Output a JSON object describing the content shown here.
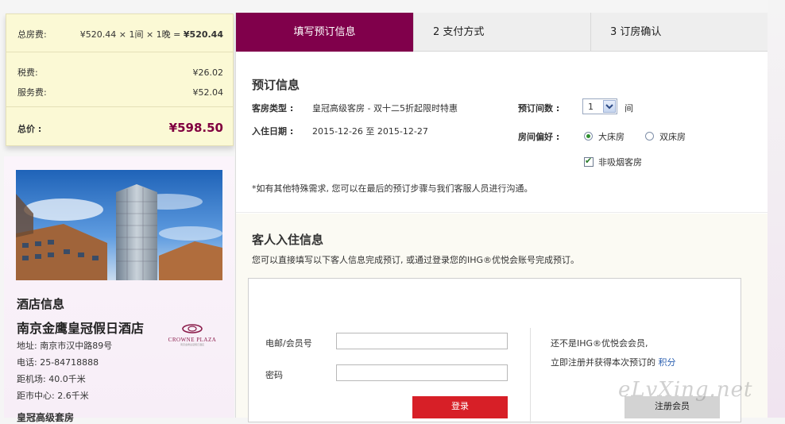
{
  "price": {
    "room_label": "总房费:",
    "room_formula": "¥520.44 × 1间 × 1晚 =",
    "room_total": "¥520.44",
    "tax_label": "税费:",
    "tax_value": "¥26.02",
    "service_label": "服务费:",
    "service_value": "¥52.04",
    "total_label": "总价 :",
    "total_value": "¥598.50"
  },
  "hotel": {
    "section_title": "酒店信息",
    "name": "南京金鹰皇冠假日酒店",
    "address": "地址: 南京市汉中路89号",
    "phone": "电话: 25-84718888",
    "airport": "距机场: 40.0千米",
    "center": "距市中心: 2.6千米",
    "room_type_cut": "皇冠高级套房",
    "brand_text": "CROWNE PLAZA",
    "brand_sub": "南京金鹰皇冠假日酒店"
  },
  "tabs": [
    {
      "label": "填写预订信息"
    },
    {
      "label": "2   支付方式"
    },
    {
      "label": "3   订房确认"
    }
  ],
  "booking": {
    "title": "预订信息",
    "room_type_label": "客房类型 :",
    "room_type_value": "皇冠高级客房 - 双十二5折起限时特惠",
    "date_label": "入住日期 :",
    "date_value": "2015-12-26  至  2015-12-27",
    "rooms_label": "预订间数 :",
    "rooms_value": "1",
    "rooms_unit": "间",
    "pref_label": "房间偏好 :",
    "pref_options": [
      "大床房",
      "双床房"
    ],
    "smoke_option": "非吸烟客房",
    "note": "*如有其他特殊需求, 您可以在最后的预订步骤与我们客服人员进行沟通。"
  },
  "guest": {
    "title": "客人入住信息",
    "desc": "您可以直接填写以下客人信息完成预订, 或通过登录您的IHG®优悦会账号完成预订。",
    "email_label": "电邮/会员号",
    "password_label": "密码",
    "login_button": "登录",
    "not_member": "还不是IHG®优悦会会员,",
    "register_hint": "立即注册并获得本次预订的",
    "points_link": "积分",
    "register_button": "注册会员"
  },
  "watermark": "eLvXing.net"
}
